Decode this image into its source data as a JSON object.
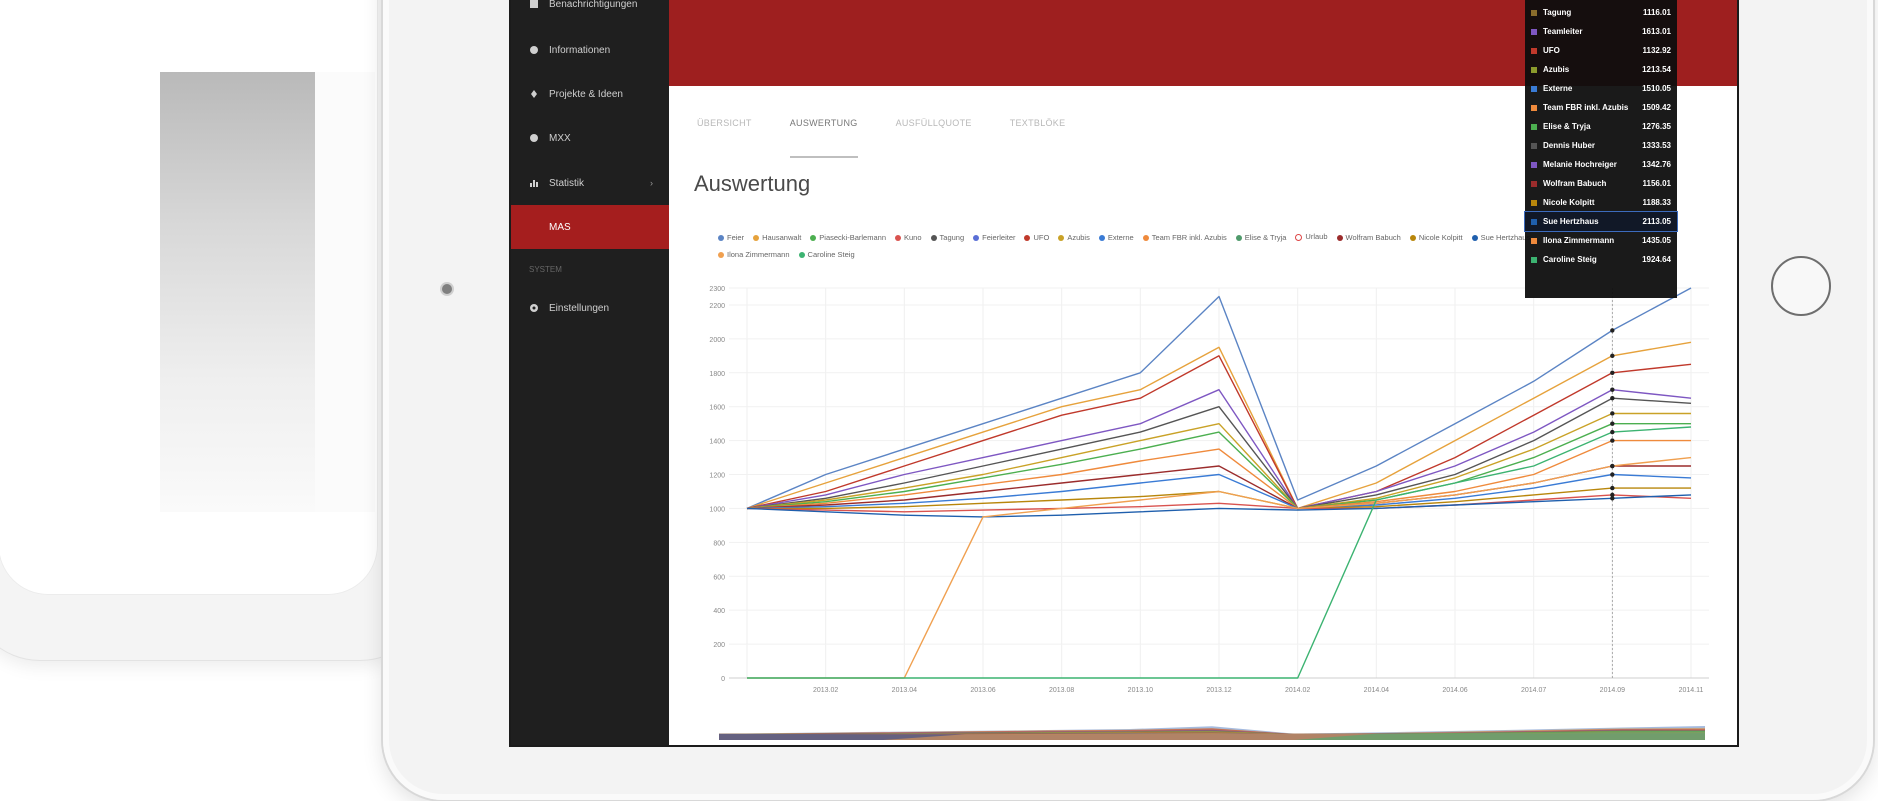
{
  "sidebar": {
    "items": [
      {
        "label": "Benachrichtigungen",
        "icon": "bell-icon"
      },
      {
        "label": "Informationen",
        "icon": "info-icon"
      },
      {
        "label": "Projekte & Ideen",
        "icon": "bulb-icon"
      },
      {
        "label": "MXX",
        "icon": "circle-icon"
      },
      {
        "label": "Statistik",
        "icon": "chart-icon"
      },
      {
        "label": "MAS",
        "icon": ""
      },
      {
        "label": "Einstellungen",
        "icon": "gear-icon"
      }
    ],
    "section_label": "SYSTEM"
  },
  "tabs": [
    "ÜBERSICHT",
    "AUSWERTUNG",
    "AUSFÜLLQUOTE",
    "TEXTBLÖKE"
  ],
  "page_title": "Auswertung",
  "legend": [
    {
      "name": "Feier",
      "color": "#5b84c4"
    },
    {
      "name": "Hausanwalt",
      "color": "#e6a23c"
    },
    {
      "name": "Piasecki-Barlemann",
      "color": "#4caf50"
    },
    {
      "name": "Kuno",
      "color": "#d9534f"
    },
    {
      "name": "Tagung",
      "color": "#555555"
    },
    {
      "name": "Feierleiter",
      "color": "#5a6fd6"
    },
    {
      "name": "UFO",
      "color": "#c0392b"
    },
    {
      "name": "Azubis",
      "color": "#c9a227"
    },
    {
      "name": "Externe",
      "color": "#3a7bd5"
    },
    {
      "name": "Team FBR inkl. Azubis",
      "color": "#ef8a3c"
    },
    {
      "name": "Elise & Tryja",
      "color": "#4f9a6b"
    },
    {
      "name": "Urlaub",
      "color": "#e05555"
    },
    {
      "name": "Wolfram Babuch",
      "color": "#9b2c2c"
    },
    {
      "name": "Nicole Kolpitt",
      "color": "#b8860b"
    },
    {
      "name": "Sue Hertzhaus",
      "color": "#1f5fad"
    },
    {
      "name": "Ilona Zimmermann",
      "color": "#f0a050"
    },
    {
      "name": "Caroline Steig",
      "color": "#3cb371"
    }
  ],
  "tooltip": {
    "rows": [
      {
        "name": "Tagung",
        "value": "1116.01",
        "color": "#8a6d2c"
      },
      {
        "name": "Teamleiter",
        "value": "1613.01",
        "color": "#7e57c2"
      },
      {
        "name": "UFO",
        "value": "1132.92",
        "color": "#c0392b"
      },
      {
        "name": "Azubis",
        "value": "1213.54",
        "color": "#8b9a2c"
      },
      {
        "name": "Externe",
        "value": "1510.05",
        "color": "#3a7bd5"
      },
      {
        "name": "Team FBR inkl. Azubis",
        "value": "1509.42",
        "color": "#ef8a3c"
      },
      {
        "name": "Elise & Tryja",
        "value": "1276.35",
        "color": "#4caf50"
      },
      {
        "name": "Dennis Huber",
        "value": "1333.53",
        "color": "#555555"
      },
      {
        "name": "Melanie Hochreiger",
        "value": "1342.76",
        "color": "#7e57c2"
      },
      {
        "name": "Wolfram Babuch",
        "value": "1156.01",
        "color": "#9b2c2c"
      },
      {
        "name": "Nicole Kolpitt",
        "value": "1188.33",
        "color": "#b8860b"
      },
      {
        "name": "Sue Hertzhaus",
        "value": "2113.05",
        "color": "#1f5fad",
        "highlight": true
      },
      {
        "name": "Ilona Zimmermann",
        "value": "1435.05",
        "color": "#ef8a3c"
      },
      {
        "name": "Caroline Steig",
        "value": "1924.64",
        "color": "#3cb371"
      }
    ]
  },
  "chart_data": {
    "type": "line",
    "x": [
      "",
      "2013.02",
      "2013.04",
      "2013.06",
      "2013.08",
      "2013.10",
      "2013.12",
      "2014.02",
      "2014.04",
      "2014.06",
      "2014.07",
      "2014.09",
      "2014.11"
    ],
    "ytick_labels": [
      "0",
      "200",
      "400",
      "600",
      "800",
      "1000",
      "1200",
      "1400",
      "1600",
      "1800",
      "2000",
      "2200",
      "2300"
    ],
    "ylim": [
      0,
      2300
    ],
    "grid": true,
    "series": [
      {
        "color": "#5b84c4",
        "values": [
          1000,
          1200,
          1350,
          1500,
          1650,
          1800,
          2250,
          1050,
          1250,
          1500,
          1750,
          2050,
          2300
        ]
      },
      {
        "color": "#e6a23c",
        "values": [
          1000,
          1150,
          1300,
          1450,
          1600,
          1700,
          1950,
          1000,
          1150,
          1400,
          1650,
          1900,
          1980
        ]
      },
      {
        "color": "#c0392b",
        "values": [
          1000,
          1100,
          1250,
          1400,
          1550,
          1650,
          1900,
          1000,
          1100,
          1300,
          1550,
          1800,
          1850
        ]
      },
      {
        "color": "#7e57c2",
        "values": [
          1000,
          1080,
          1200,
          1300,
          1400,
          1500,
          1700,
          1000,
          1100,
          1250,
          1450,
          1700,
          1650
        ]
      },
      {
        "color": "#555555",
        "values": [
          1000,
          1060,
          1150,
          1250,
          1350,
          1450,
          1600,
          1000,
          1080,
          1200,
          1400,
          1650,
          1620
        ]
      },
      {
        "color": "#c9a227",
        "values": [
          1000,
          1050,
          1120,
          1200,
          1300,
          1400,
          1500,
          1000,
          1060,
          1180,
          1350,
          1560,
          1560
        ]
      },
      {
        "color": "#4caf50",
        "values": [
          1000,
          1040,
          1100,
          1180,
          1260,
          1350,
          1450,
          1000,
          1050,
          1150,
          1300,
          1500,
          1500
        ]
      },
      {
        "color": "#ef8a3c",
        "values": [
          1000,
          1030,
          1080,
          1140,
          1200,
          1280,
          1350,
          1000,
          1040,
          1100,
          1200,
          1400,
          1400
        ]
      },
      {
        "color": "#9b2c2c",
        "values": [
          1000,
          1020,
          1050,
          1100,
          1150,
          1200,
          1250,
          1000,
          1030,
          1080,
          1150,
          1250,
          1250
        ]
      },
      {
        "color": "#3a7bd5",
        "values": [
          1000,
          1010,
          1030,
          1060,
          1100,
          1150,
          1200,
          1000,
          1020,
          1060,
          1120,
          1200,
          1180
        ]
      },
      {
        "color": "#b8860b",
        "values": [
          1000,
          1000,
          1010,
          1030,
          1050,
          1070,
          1100,
          1000,
          1010,
          1040,
          1080,
          1120,
          1120
        ]
      },
      {
        "color": "#d9534f",
        "values": [
          1000,
          990,
          980,
          990,
          1000,
          1010,
          1030,
          1000,
          1000,
          1020,
          1050,
          1080,
          1060
        ]
      },
      {
        "color": "#1f5fad",
        "values": [
          1000,
          980,
          960,
          950,
          960,
          980,
          1000,
          990,
          1000,
          1020,
          1040,
          1060,
          1080
        ]
      },
      {
        "color": "#f0a050",
        "values": [
          0,
          0,
          0,
          950,
          1000,
          1050,
          1100,
          1000,
          1030,
          1080,
          1150,
          1250,
          1300
        ]
      },
      {
        "color": "#3cb371",
        "values": [
          0,
          0,
          0,
          0,
          0,
          0,
          0,
          0,
          1050,
          1150,
          1250,
          1450,
          1480
        ]
      }
    ]
  }
}
